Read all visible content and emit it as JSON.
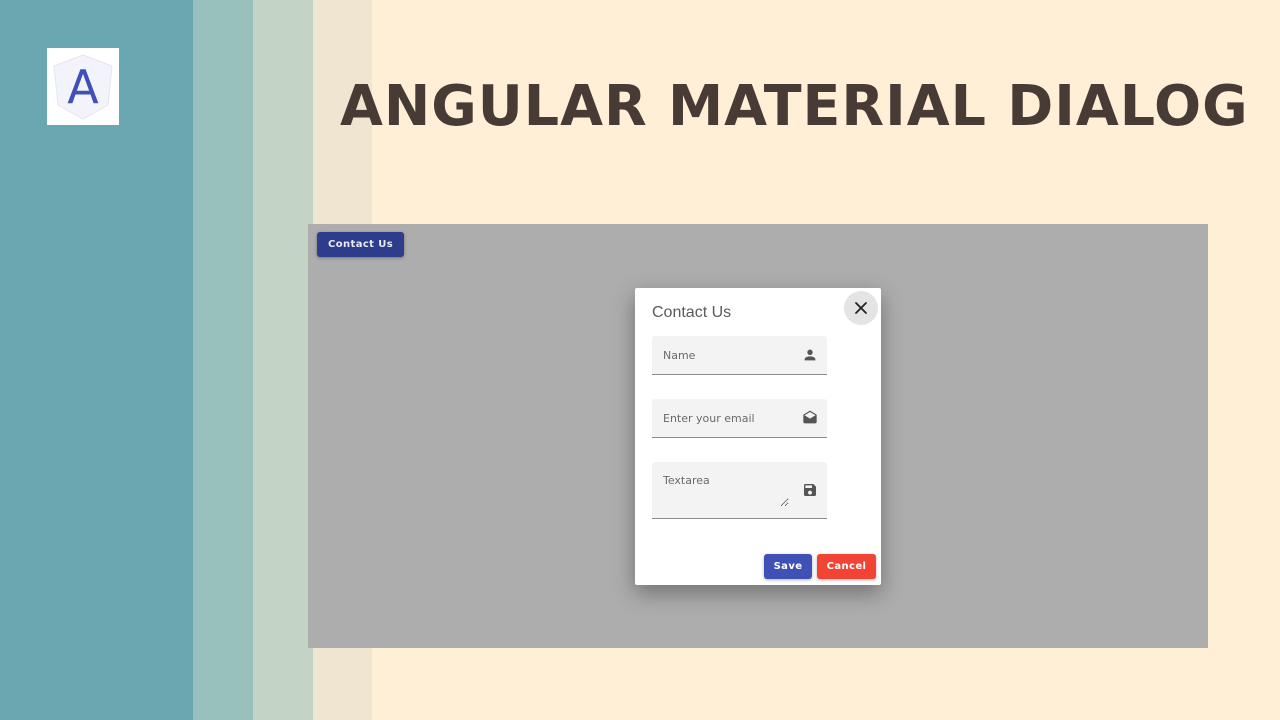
{
  "banner": {
    "headline": "ANGULAR MATERIAL DIALOG",
    "logo_icon": "angular-logo-icon",
    "logo_letter": "A",
    "colors": {
      "stripe_1": "#6aa8b1",
      "stripe_2": "#98c0bd",
      "stripe_3": "#c3d4c6",
      "stripe_4": "#efe5d0",
      "background": "#ffefd7",
      "headline": "#483b36"
    }
  },
  "app": {
    "open_dialog_button": "Contact Us",
    "overlay_color": "#adadad",
    "button_color": "#2e3c8c"
  },
  "dialog": {
    "title": "Contact Us",
    "close_icon": "close-icon",
    "fields": {
      "name": {
        "placeholder": "Name",
        "value": "",
        "icon": "person-icon"
      },
      "email": {
        "placeholder": "Enter your email",
        "value": "",
        "icon": "email-open-icon"
      },
      "textarea": {
        "placeholder": "Textarea",
        "value": "",
        "icon": "save-icon"
      }
    },
    "actions": {
      "save": "Save",
      "cancel": "Cancel",
      "save_color": "#3f51b5",
      "cancel_color": "#f24435"
    }
  }
}
